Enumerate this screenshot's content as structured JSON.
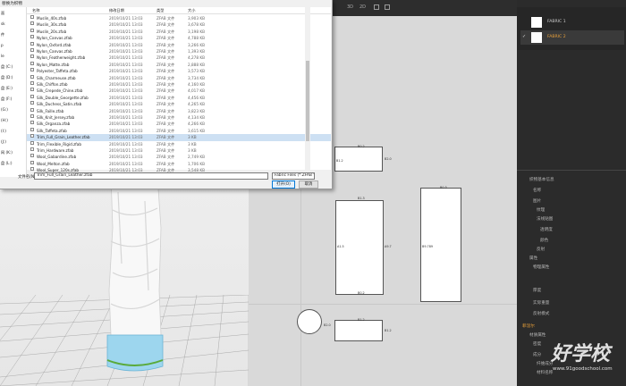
{
  "dialog": {
    "title": "替换为织物",
    "columns": {
      "name": "名称",
      "date": "修改日期",
      "type": "类型",
      "size": "大小"
    },
    "sidebar": [
      "面",
      "sk",
      "件",
      "p",
      "le",
      "盘 (C:)",
      "盘 (D:)",
      "盘 (E:)",
      "盘 (F:)",
      "(G:)",
      "(H:)",
      "(I:)",
      "(J:)",
      "网 (K:)",
      "盘 (L:)"
    ],
    "files": [
      {
        "name": "Muslin_40s.zfab",
        "date": "2019/10/21 13:03",
        "type": "ZFAB 文件",
        "size": "3,903 KB"
      },
      {
        "name": "Muslin_30s.zfab",
        "date": "2019/10/21 13:03",
        "type": "ZFAB 文件",
        "size": "3,678 KB"
      },
      {
        "name": "Muslin_20s.zfab",
        "date": "2019/10/21 13:03",
        "type": "ZFAB 文件",
        "size": "3,198 KB"
      },
      {
        "name": "Nylon_Canvas.zfab",
        "date": "2019/10/21 13:03",
        "type": "ZFAB 文件",
        "size": "4,788 KB"
      },
      {
        "name": "Nylon_Oxford.zfab",
        "date": "2019/10/21 13:03",
        "type": "ZFAB 文件",
        "size": "3,266 KB"
      },
      {
        "name": "Nylon_Canvas.zfab",
        "date": "2019/10/21 13:03",
        "type": "ZFAB 文件",
        "size": "1,393 KB"
      },
      {
        "name": "Nylon_Featherweight.zfab",
        "date": "2019/10/21 13:03",
        "type": "ZFAB 文件",
        "size": "4,278 KB"
      },
      {
        "name": "Nylon_Matte.zfab",
        "date": "2019/10/21 13:03",
        "type": "ZFAB 文件",
        "size": "2,888 KB"
      },
      {
        "name": "Polyester_Taffeta.zfab",
        "date": "2019/10/21 13:03",
        "type": "ZFAB 文件",
        "size": "3,573 KB"
      },
      {
        "name": "Silk_Charmeuse.zfab",
        "date": "2019/10/21 13:03",
        "type": "ZFAB 文件",
        "size": "3,734 KB"
      },
      {
        "name": "Silk_Chiffon.zfab",
        "date": "2019/10/21 13:03",
        "type": "ZFAB 文件",
        "size": "4,160 KB"
      },
      {
        "name": "Silk_Crepede_Chine.zfab",
        "date": "2019/10/21 13:03",
        "type": "ZFAB 文件",
        "size": "4,017 KB"
      },
      {
        "name": "Silk_Double_Georgette.zfab",
        "date": "2019/10/21 13:03",
        "type": "ZFAB 文件",
        "size": "4,456 KB"
      },
      {
        "name": "Silk_Duchess_Satin.zfab",
        "date": "2019/10/21 13:03",
        "type": "ZFAB 文件",
        "size": "4,265 KB"
      },
      {
        "name": "Silk_Faille.zfab",
        "date": "2019/10/21 13:03",
        "type": "ZFAB 文件",
        "size": "3,823 KB"
      },
      {
        "name": "Silk_Knit_Jersey.zfab",
        "date": "2019/10/21 13:03",
        "type": "ZFAB 文件",
        "size": "4,134 KB"
      },
      {
        "name": "Silk_Organza.zfab",
        "date": "2019/10/21 13:03",
        "type": "ZFAB 文件",
        "size": "4,266 KB"
      },
      {
        "name": "Silk_Taffeta.zfab",
        "date": "2019/10/21 13:03",
        "type": "ZFAB 文件",
        "size": "3,615 KB"
      },
      {
        "name": "Trim_Full_Grain_Leather.zfab",
        "date": "2019/10/21 13:03",
        "type": "ZFAB 文件",
        "size": "3 KB"
      },
      {
        "name": "Trim_Flexible_Rigid.zfab",
        "date": "2019/10/21 13:03",
        "type": "ZFAB 文件",
        "size": "3 KB"
      },
      {
        "name": "Trim_Hardware.zfab",
        "date": "2019/10/21 13:03",
        "type": "ZFAB 文件",
        "size": "3 KB"
      },
      {
        "name": "Wool_Gabardine.zfab",
        "date": "2019/10/21 13:03",
        "type": "ZFAB 文件",
        "size": "2,749 KB"
      },
      {
        "name": "Wool_Melton.zfab",
        "date": "2019/10/21 13:03",
        "type": "ZFAB 文件",
        "size": "1,706 KB"
      },
      {
        "name": "Wool_Super_120s.zfab",
        "date": "2019/10/21 13:03",
        "type": "ZFAB 文件",
        "size": "3,548 KB"
      }
    ],
    "selected_index": 18,
    "filename_label": "文件名(N):",
    "filename_value": "Trim_Full_Grain_Leather.zfab",
    "filter_value": "Fabric Files (*.ZFAB *.JFAB)",
    "open_label": "打开(O)",
    "cancel_label": "取消"
  },
  "pattern": {
    "top_labels": [
      "3D",
      "2D"
    ],
    "labels": [
      "B0.2",
      "B1.2",
      "B2.0",
      "B1.3",
      "A1.5",
      "A9.7",
      "B0.2",
      "B0.3",
      "B9.789",
      "B1.2",
      "B2.0",
      "B1.2"
    ]
  },
  "right_panel": {
    "fabrics": [
      "FABRIC 1",
      "FABRIC 2"
    ],
    "tree_items": [
      "织物基本信息",
      "名称",
      "图片",
      "纹理",
      "法线贴图",
      "透明度",
      "颜色",
      "反射",
      "属性",
      "物理属性",
      "厚度",
      "实际重量",
      "反射模式",
      "菲涅尔",
      "材质属性",
      "密度",
      "成分",
      "纤维成分",
      "材料名称",
      "厂商信息"
    ]
  },
  "watermark": {
    "brand": "好学校",
    "url": "www.91goodschool.com"
  },
  "colors": {
    "accent": "#0078d7",
    "cloth": "#ffffff",
    "band": "#7ec8e8",
    "panel": "#2b2b2b"
  }
}
